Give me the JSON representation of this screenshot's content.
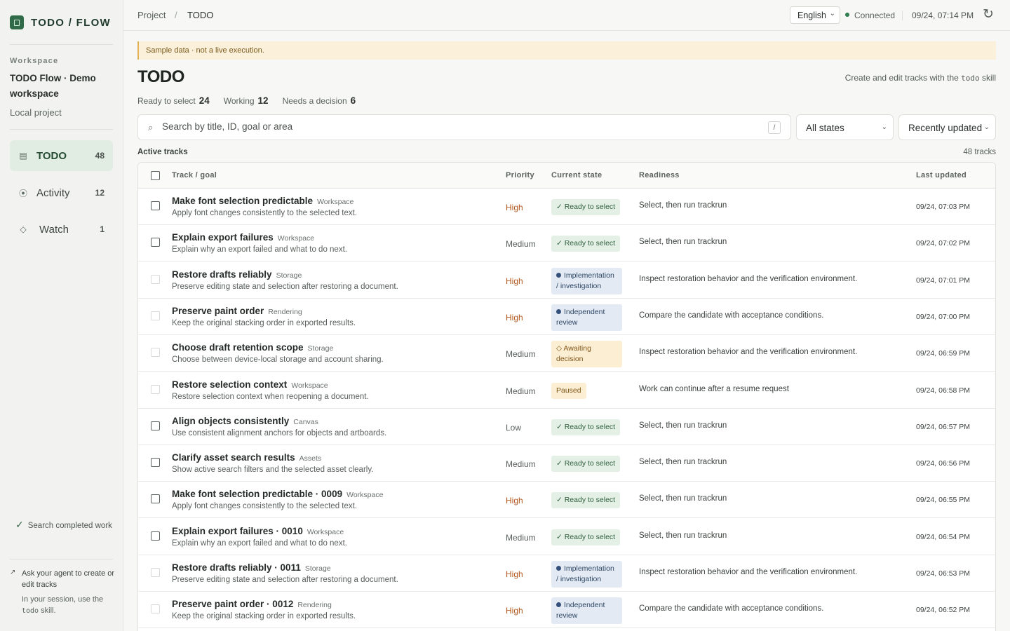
{
  "brand": {
    "name": "TODO / FLOW"
  },
  "sidebar": {
    "workspace_label": "Workspace",
    "workspace_name": "TODO Flow · Demo workspace",
    "workspace_sub": "Local project",
    "nav": [
      {
        "label": "TODO",
        "count": "48",
        "icon": "list-icon"
      },
      {
        "label": "Activity",
        "count": "12",
        "icon": "activity-icon"
      },
      {
        "label": "Watch",
        "count": "1",
        "icon": "diamond-icon"
      }
    ],
    "status_text": "Search completed work",
    "help_title": "Ask your agent to create or edit tracks",
    "help_text_pre": "In your session, use the",
    "help_code": "todo",
    "help_text_post": "skill."
  },
  "topbar": {
    "breadcrumb": [
      "Project",
      "/",
      "TODO"
    ],
    "language": "English",
    "connection": "Connected",
    "timestamp": "09/24, 07:14 PM"
  },
  "banner": "Sample data · not a live execution.",
  "page": {
    "title": "TODO",
    "hint_pre": "Create and edit tracks with the",
    "hint_code": "todo",
    "hint_post": "skill"
  },
  "stats": [
    {
      "label": "Ready to select",
      "value": "24"
    },
    {
      "label": "Working",
      "value": "12"
    },
    {
      "label": "Needs a decision",
      "value": "6"
    }
  ],
  "search": {
    "placeholder": "Search by title, ID, goal or area",
    "shortcut": "/"
  },
  "filters": {
    "state": "All states",
    "sort": "Recently updated"
  },
  "section": {
    "label": "Active tracks",
    "count": "48 tracks"
  },
  "columns": [
    "Track / goal",
    "Priority",
    "Current state",
    "Readiness",
    "Last updated"
  ],
  "rows": [
    {
      "title": "Make font selection predictable",
      "area": "Workspace",
      "desc": "Apply font changes consistently to the selected text.",
      "priority": "High",
      "state": "Ready to select",
      "state_kind": "ready",
      "readiness": "Select, then run trackrun",
      "updated": "09/24, 07:03 PM",
      "selectable": true
    },
    {
      "title": "Explain export failures",
      "area": "Workspace",
      "desc": "Explain why an export failed and what to do next.",
      "priority": "Medium",
      "state": "Ready to select",
      "state_kind": "ready",
      "readiness": "Select, then run trackrun",
      "updated": "09/24, 07:02 PM",
      "selectable": true
    },
    {
      "title": "Restore drafts reliably",
      "area": "Storage",
      "desc": "Preserve editing state and selection after restoring a document.",
      "priority": "High",
      "state": "Implementation / investigation",
      "state_kind": "impl",
      "readiness": "Inspect restoration behavior and the verification environment.",
      "updated": "09/24, 07:01 PM",
      "selectable": false
    },
    {
      "title": "Preserve paint order",
      "area": "Rendering",
      "desc": "Keep the original stacking order in exported results.",
      "priority": "High",
      "state": "Independent review",
      "state_kind": "review",
      "readiness": "Compare the candidate with acceptance conditions.",
      "updated": "09/24, 07:00 PM",
      "selectable": false
    },
    {
      "title": "Choose draft retention scope",
      "area": "Storage",
      "desc": "Choose between device-local storage and account sharing.",
      "priority": "Medium",
      "state": "Awaiting decision",
      "state_kind": "await",
      "readiness": "Inspect restoration behavior and the verification environment.",
      "updated": "09/24, 06:59 PM",
      "selectable": false
    },
    {
      "title": "Restore selection context",
      "area": "Workspace",
      "desc": "Restore selection context when reopening a document.",
      "priority": "Medium",
      "state": "Paused",
      "state_kind": "paused",
      "readiness": "Work can continue after a resume request",
      "updated": "09/24, 06:58 PM",
      "selectable": false
    },
    {
      "title": "Align objects consistently",
      "area": "Canvas",
      "desc": "Use consistent alignment anchors for objects and artboards.",
      "priority": "Low",
      "state": "Ready to select",
      "state_kind": "ready",
      "readiness": "Select, then run trackrun",
      "updated": "09/24, 06:57 PM",
      "selectable": true
    },
    {
      "title": "Clarify asset search results",
      "area": "Assets",
      "desc": "Show active search filters and the selected asset clearly.",
      "priority": "Medium",
      "state": "Ready to select",
      "state_kind": "ready",
      "readiness": "Select, then run trackrun",
      "updated": "09/24, 06:56 PM",
      "selectable": true
    },
    {
      "title": "Make font selection predictable · 0009",
      "area": "Workspace",
      "desc": "Apply font changes consistently to the selected text.",
      "priority": "High",
      "state": "Ready to select",
      "state_kind": "ready",
      "readiness": "Select, then run trackrun",
      "updated": "09/24, 06:55 PM",
      "selectable": true
    },
    {
      "title": "Explain export failures · 0010",
      "area": "Workspace",
      "desc": "Explain why an export failed and what to do next.",
      "priority": "Medium",
      "state": "Ready to select",
      "state_kind": "ready",
      "readiness": "Select, then run trackrun",
      "updated": "09/24, 06:54 PM",
      "selectable": true
    },
    {
      "title": "Restore drafts reliably · 0011",
      "area": "Storage",
      "desc": "Preserve editing state and selection after restoring a document.",
      "priority": "High",
      "state": "Implementation / investigation",
      "state_kind": "impl",
      "readiness": "Inspect restoration behavior and the verification environment.",
      "updated": "09/24, 06:53 PM",
      "selectable": false
    },
    {
      "title": "Preserve paint order · 0012",
      "area": "Rendering",
      "desc": "Keep the original stacking order in exported results.",
      "priority": "High",
      "state": "Independent review",
      "state_kind": "review",
      "readiness": "Compare the candidate with acceptance conditions.",
      "updated": "09/24, 06:52 PM",
      "selectable": false
    }
  ],
  "colors": {
    "accent": "#2f6b46",
    "high": "#b3561b",
    "banner": "#fbf0d9"
  }
}
